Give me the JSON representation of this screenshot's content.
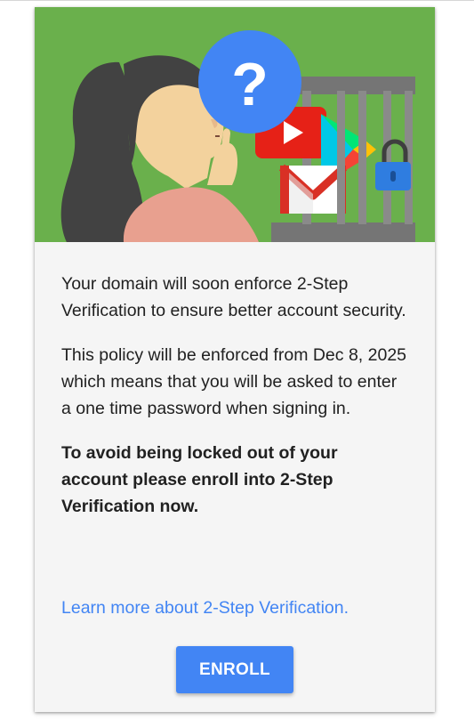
{
  "notice": {
    "paragraph1": "Your domain will soon enforce 2-Step Verification to ensure better account security.",
    "paragraph2": "This policy will be enforced from Dec 8, 2025 which means that you will be asked to enter a one time password when signing in.",
    "paragraph3": "To avoid being locked out of your account please enroll into 2-Step Verification now.",
    "learn_more_link": "Learn more about 2-Step Verification.",
    "enroll_button": "ENROLL"
  },
  "illustration": {
    "question_mark": "?",
    "icons": [
      "woman-thinking-icon",
      "question-icon",
      "youtube-icon",
      "play-store-icon",
      "gmail-icon",
      "padlock-icon",
      "cage-icon"
    ]
  },
  "colors": {
    "hero_background": "#6ab04c",
    "accent_blue": "#4285f4",
    "card_background": "#f5f5f5",
    "text": "#212121"
  }
}
